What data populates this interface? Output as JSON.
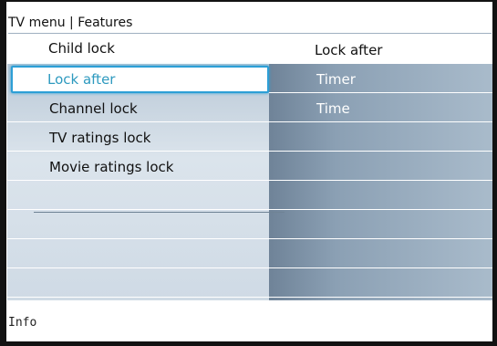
{
  "breadcrumb": "TV menu | Features",
  "header": {
    "left": "Child lock",
    "right": "Lock after"
  },
  "left_items": [
    {
      "label": "Lock after",
      "selected": true
    },
    {
      "label": "Channel lock"
    },
    {
      "label": "TV ratings lock"
    },
    {
      "label": "Movie ratings lock"
    },
    {
      "label": ""
    },
    {
      "label": ""
    },
    {
      "label": ""
    },
    {
      "label": ""
    }
  ],
  "right_items": [
    {
      "label": "Timer"
    },
    {
      "label": "Time"
    },
    {
      "label": ""
    },
    {
      "label": ""
    },
    {
      "label": ""
    },
    {
      "label": ""
    },
    {
      "label": ""
    },
    {
      "label": ""
    }
  ],
  "info_label": "Info",
  "colors": {
    "selection_border": "#2d9fd6",
    "selected_text": "#2e9abf"
  }
}
